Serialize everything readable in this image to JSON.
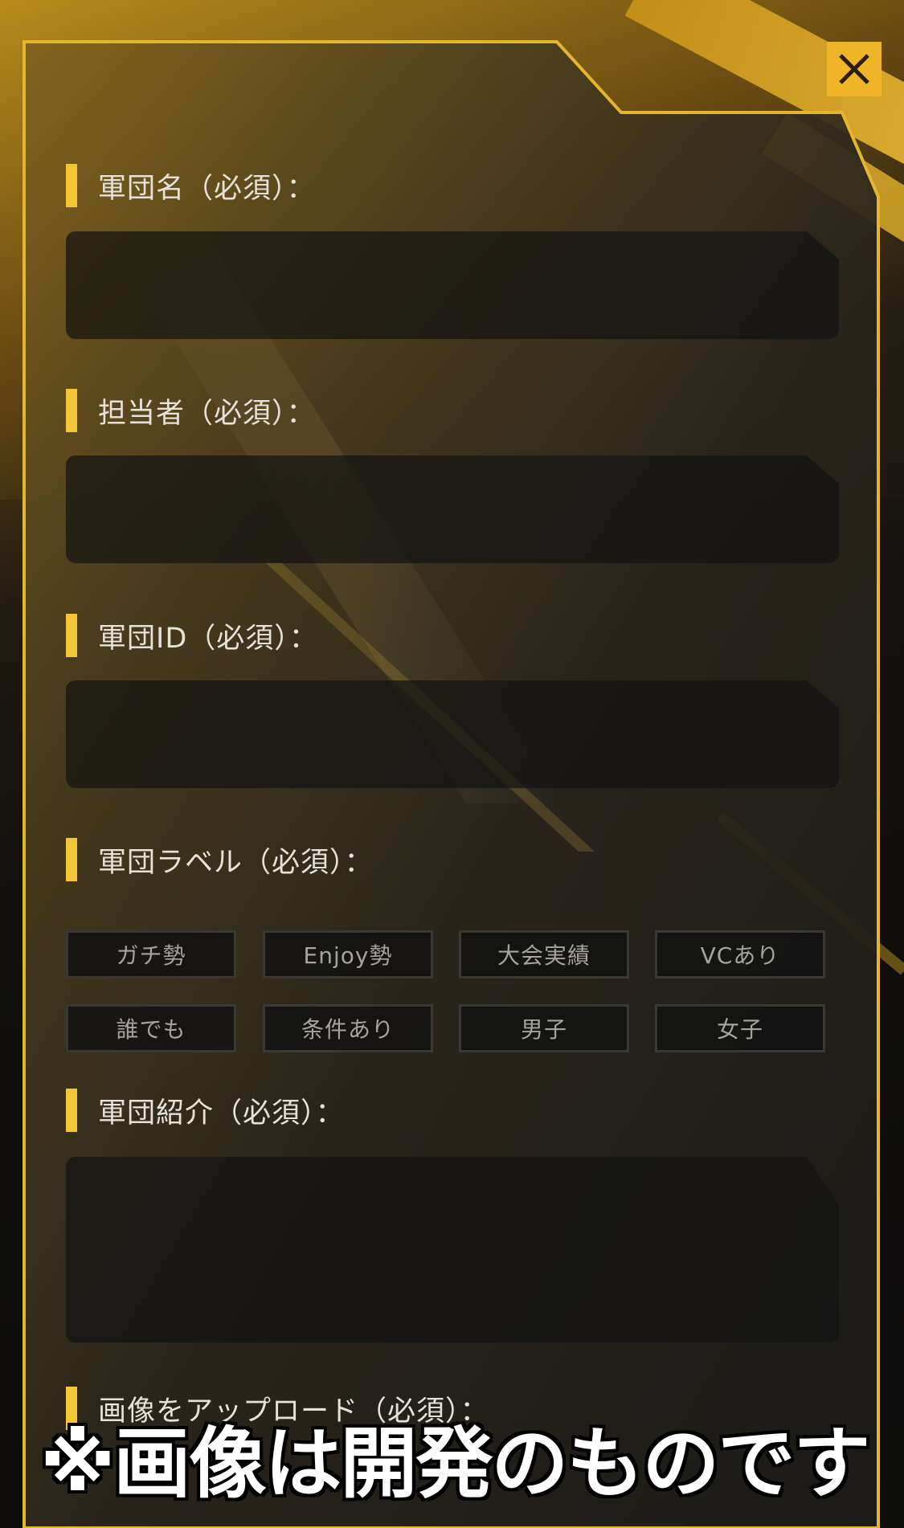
{
  "colors": {
    "accent": "#f4c637",
    "close_button_bg": "#f0b429",
    "panel_border": "#e5b52e",
    "input_bg": "#141414",
    "tag_border": "#3a3835",
    "label_text": "#e6e2da",
    "tag_text": "#a6a39c",
    "caption_text": "#ffffff",
    "caption_outline": "#000000"
  },
  "close_button": {
    "icon": "close-icon"
  },
  "form": {
    "corps_name": {
      "label": "軍団名（必須）：",
      "value": "",
      "placeholder": ""
    },
    "manager": {
      "label": "担当者（必須）：",
      "value": "",
      "placeholder": ""
    },
    "corps_id": {
      "label": "軍団ID（必須）：",
      "value": "",
      "placeholder": ""
    },
    "corps_labels": {
      "label": "軍団ラベル（必須）：",
      "tags": [
        "ガチ勢",
        "Enjoy勢",
        "大会実績",
        "VCあり",
        "誰でも",
        "条件あり",
        "男子",
        "女子"
      ]
    },
    "corps_intro": {
      "label": "軍団紹介（必須）：",
      "value": "",
      "placeholder": ""
    },
    "image_upload": {
      "label": "画像をアップロード（必須）："
    }
  },
  "overlay_caption": "※画像は開発のものです"
}
